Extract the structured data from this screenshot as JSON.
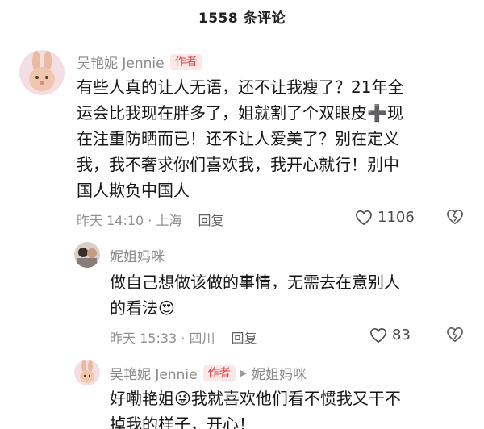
{
  "header": {
    "title": "1558 条评论"
  },
  "comments": [
    {
      "author": "吴艳妮 Jennie",
      "badge": "作者",
      "lines": [
        "有些人真的让人无语，还不让我瘦了？21年全",
        "运会比我现在胖多了，姐就割了个双眼皮➕现",
        "在注重防晒而已！还不让人爱美了？别在定义",
        "我，我不奢求你们喜欢我，我开心就行！别中",
        "国人欺负中国人"
      ],
      "time": "昨天 14:10 · 上海",
      "reply_label": "回复",
      "likes": "1106"
    },
    {
      "author": "妮姐妈咪",
      "lines": [
        "做自己想做该做的事情，无需去在意别人",
        "的看法😍"
      ],
      "time": "昨天 15:33 · 四川",
      "reply_label": "回复",
      "likes": "83"
    },
    {
      "author": "吴艳妮 Jennie",
      "badge": "作者",
      "reply_to": "妮姐妈咪",
      "lines": [
        "好嘞艳姐😜我就喜欢他们看不惯我又干不",
        "掉我的样子，开心！"
      ]
    }
  ],
  "icons": {
    "like": "heart-outline-icon",
    "dislike": "broken-heart-icon",
    "reply_arrow": "play-triangle-icon"
  },
  "colors": {
    "badge_bg": "#fde6e6",
    "badge_text": "#e23a3a",
    "meta": "#8f8f8f"
  }
}
